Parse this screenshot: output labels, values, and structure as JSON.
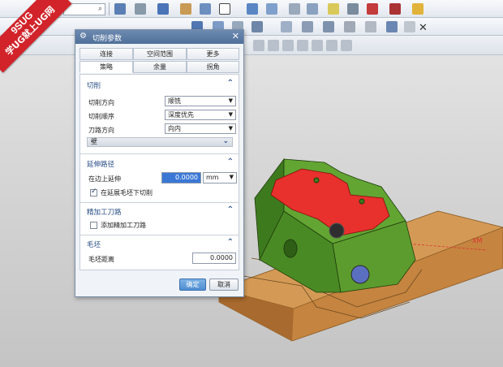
{
  "logo": {
    "line1": "9SUG",
    "line2": "学UG就上UG网"
  },
  "viewport": {
    "axis_label": "XM"
  },
  "dialog": {
    "title": "切削参数",
    "tabs_top": [
      "连接",
      "空间范围",
      "更多"
    ],
    "tabs_bottom": [
      "策略",
      "余量",
      "拐角"
    ],
    "active_tab": "策略",
    "sections": {
      "cut": {
        "title": "切削",
        "direction_label": "切削方向",
        "direction_value": "顺铣",
        "order_label": "切削顺序",
        "order_value": "深度优先",
        "path_label": "刀路方向",
        "path_value": "向内",
        "wall_label": "壁"
      },
      "extend": {
        "title": "延伸路径",
        "edge_label": "在边上延伸",
        "edge_value": "0.0000",
        "unit": "mm",
        "blank_label": "在延展毛坯下切削",
        "blank_checked": true
      },
      "finish": {
        "title": "精加工刀路",
        "add_label": "添加精加工刀路",
        "add_checked": false
      },
      "blank": {
        "title": "毛坯",
        "distance_label": "毛坯距离",
        "distance_value": "0.0000"
      }
    },
    "buttons": {
      "ok": "确定",
      "cancel": "取消"
    }
  }
}
